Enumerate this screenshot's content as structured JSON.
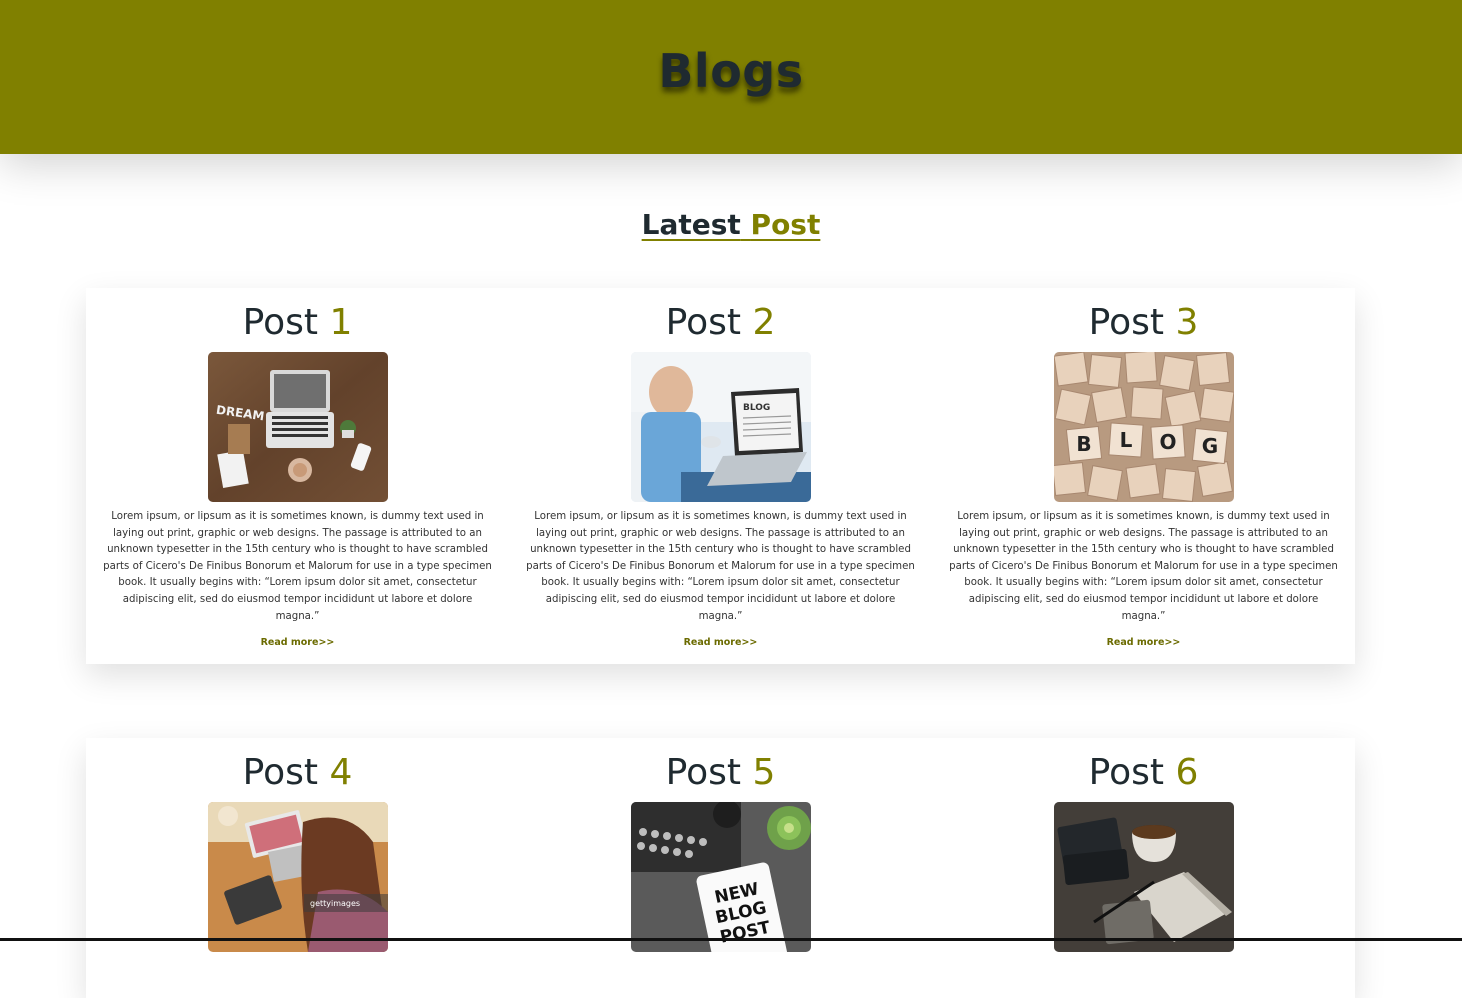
{
  "header": {
    "title": "Blogs"
  },
  "section": {
    "title_part1": "Latest",
    "title_part2": "Post"
  },
  "colors": {
    "accent": "#808000",
    "text_dark": "#1f2a30"
  },
  "posts": [
    {
      "label": "Post",
      "number": "1",
      "image": "desk-laptop-dream-photo",
      "text": "Lorem ipsum, or lipsum as it is sometimes known, is dummy text used in laying out print, graphic or web designs. The passage is attributed to an unknown typesetter in the 15th century who is thought to have scrambled parts of Cicero's De Finibus Bonorum et Malorum for use in a type specimen book. It usually begins with: “Lorem ipsum dolor sit amet, consectetur adipiscing elit, sed do eiusmod tempor incididunt ut labore et dolore magna.”",
      "link": "Read more>>"
    },
    {
      "label": "Post",
      "number": "2",
      "image": "man-typing-blog-photo",
      "text": "Lorem ipsum, or lipsum as it is sometimes known, is dummy text used in laying out print, graphic or web designs. The passage is attributed to an unknown typesetter in the 15th century who is thought to have scrambled parts of Cicero's De Finibus Bonorum et Malorum for use in a type specimen book. It usually begins with: “Lorem ipsum dolor sit amet, consectetur adipiscing elit, sed do eiusmod tempor incididunt ut labore et dolore magna.”",
      "link": "Read more>>"
    },
    {
      "label": "Post",
      "number": "3",
      "image": "scrabble-blog-tiles-photo",
      "text": "Lorem ipsum, or lipsum as it is sometimes known, is dummy text used in laying out print, graphic or web designs. The passage is attributed to an unknown typesetter in the 15th century who is thought to have scrambled parts of Cicero's De Finibus Bonorum et Malorum for use in a type specimen book. It usually begins with: “Lorem ipsum dolor sit amet, consectetur adipiscing elit, sed do eiusmod tempor incididunt ut labore et dolore magna.”",
      "link": "Read more>>"
    },
    {
      "label": "Post",
      "number": "4",
      "image": "woman-laptop-photo"
    },
    {
      "label": "Post",
      "number": "5",
      "image": "new-blog-post-notebook-photo"
    },
    {
      "label": "Post",
      "number": "6",
      "image": "coffee-notebook-desk-photo"
    }
  ],
  "image_text": {
    "dream": "DREAM",
    "blog_screen": "BLOG",
    "tiles": [
      "B",
      "L",
      "O",
      "G"
    ],
    "new_blog_post": [
      "NEW",
      "BLOG",
      "POST"
    ],
    "watermark": "gettyimages"
  }
}
